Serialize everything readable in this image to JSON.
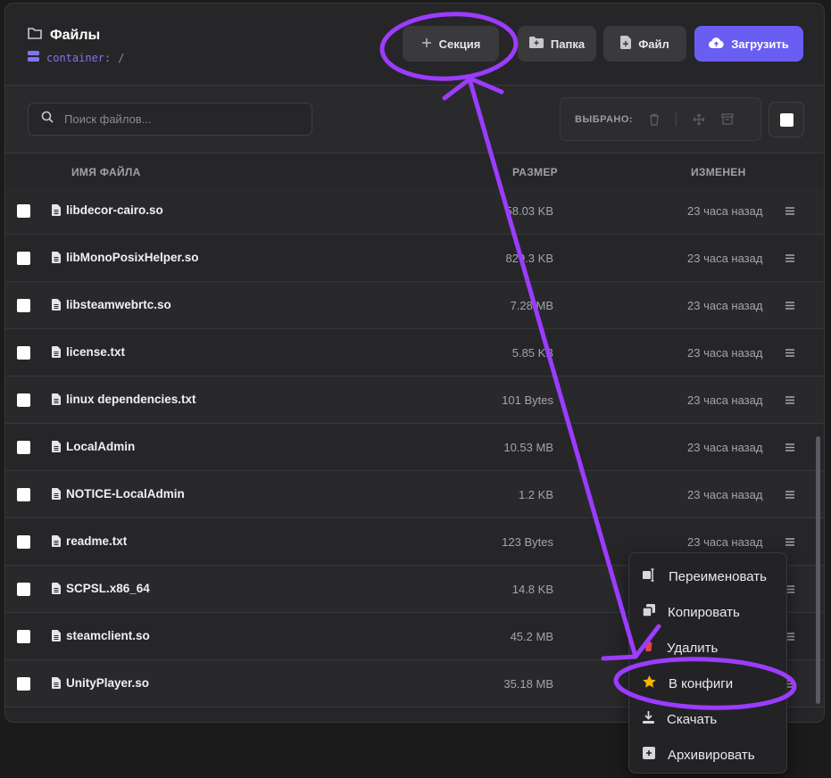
{
  "header": {
    "title": "Файлы",
    "path_container": "container:",
    "path_sep": "/",
    "buttons": {
      "section": "Секция",
      "folder": "Папка",
      "file": "Файл",
      "upload": "Загрузить"
    }
  },
  "toolbar": {
    "search_placeholder": "Поиск файлов...",
    "selected_label": "ВЫБРАНО:"
  },
  "table": {
    "columns": {
      "name": "ИМЯ ФАЙЛА",
      "size": "РАЗМЕР",
      "modified": "ИЗМЕНЕН"
    },
    "rows": [
      {
        "name": "libdecor-cairo.so",
        "size": "58.03 KB",
        "modified": "23 часа назад"
      },
      {
        "name": "libMonoPosixHelper.so",
        "size": "829.3 KB",
        "modified": "23 часа назад"
      },
      {
        "name": "libsteamwebrtc.so",
        "size": "7.28 MB",
        "modified": "23 часа назад"
      },
      {
        "name": "license.txt",
        "size": "5.85 KB",
        "modified": "23 часа назад"
      },
      {
        "name": "linux dependencies.txt",
        "size": "101 Bytes",
        "modified": "23 часа назад"
      },
      {
        "name": "LocalAdmin",
        "size": "10.53 MB",
        "modified": "23 часа назад"
      },
      {
        "name": "NOTICE-LocalAdmin",
        "size": "1.2 KB",
        "modified": "23 часа назад"
      },
      {
        "name": "readme.txt",
        "size": "123 Bytes",
        "modified": "23 часа назад"
      },
      {
        "name": "SCPSL.x86_64",
        "size": "14.8 KB",
        "modified": ""
      },
      {
        "name": "steamclient.so",
        "size": "45.2 MB",
        "modified": ""
      },
      {
        "name": "UnityPlayer.so",
        "size": "35.18 MB",
        "modified": ""
      }
    ]
  },
  "context_menu": {
    "items": [
      {
        "label": "Переименовать",
        "icon": "rename-icon"
      },
      {
        "label": "Копировать",
        "icon": "copy-icon"
      },
      {
        "label": "Удалить",
        "icon": "trash-icon"
      },
      {
        "label": "В конфиги",
        "icon": "star-icon"
      },
      {
        "label": "Скачать",
        "icon": "download-icon"
      },
      {
        "label": "Архивировать",
        "icon": "archive-icon"
      }
    ]
  },
  "colors": {
    "accent": "#6a5df2",
    "annotation": "#9b3cff",
    "star": "#f5b400"
  }
}
